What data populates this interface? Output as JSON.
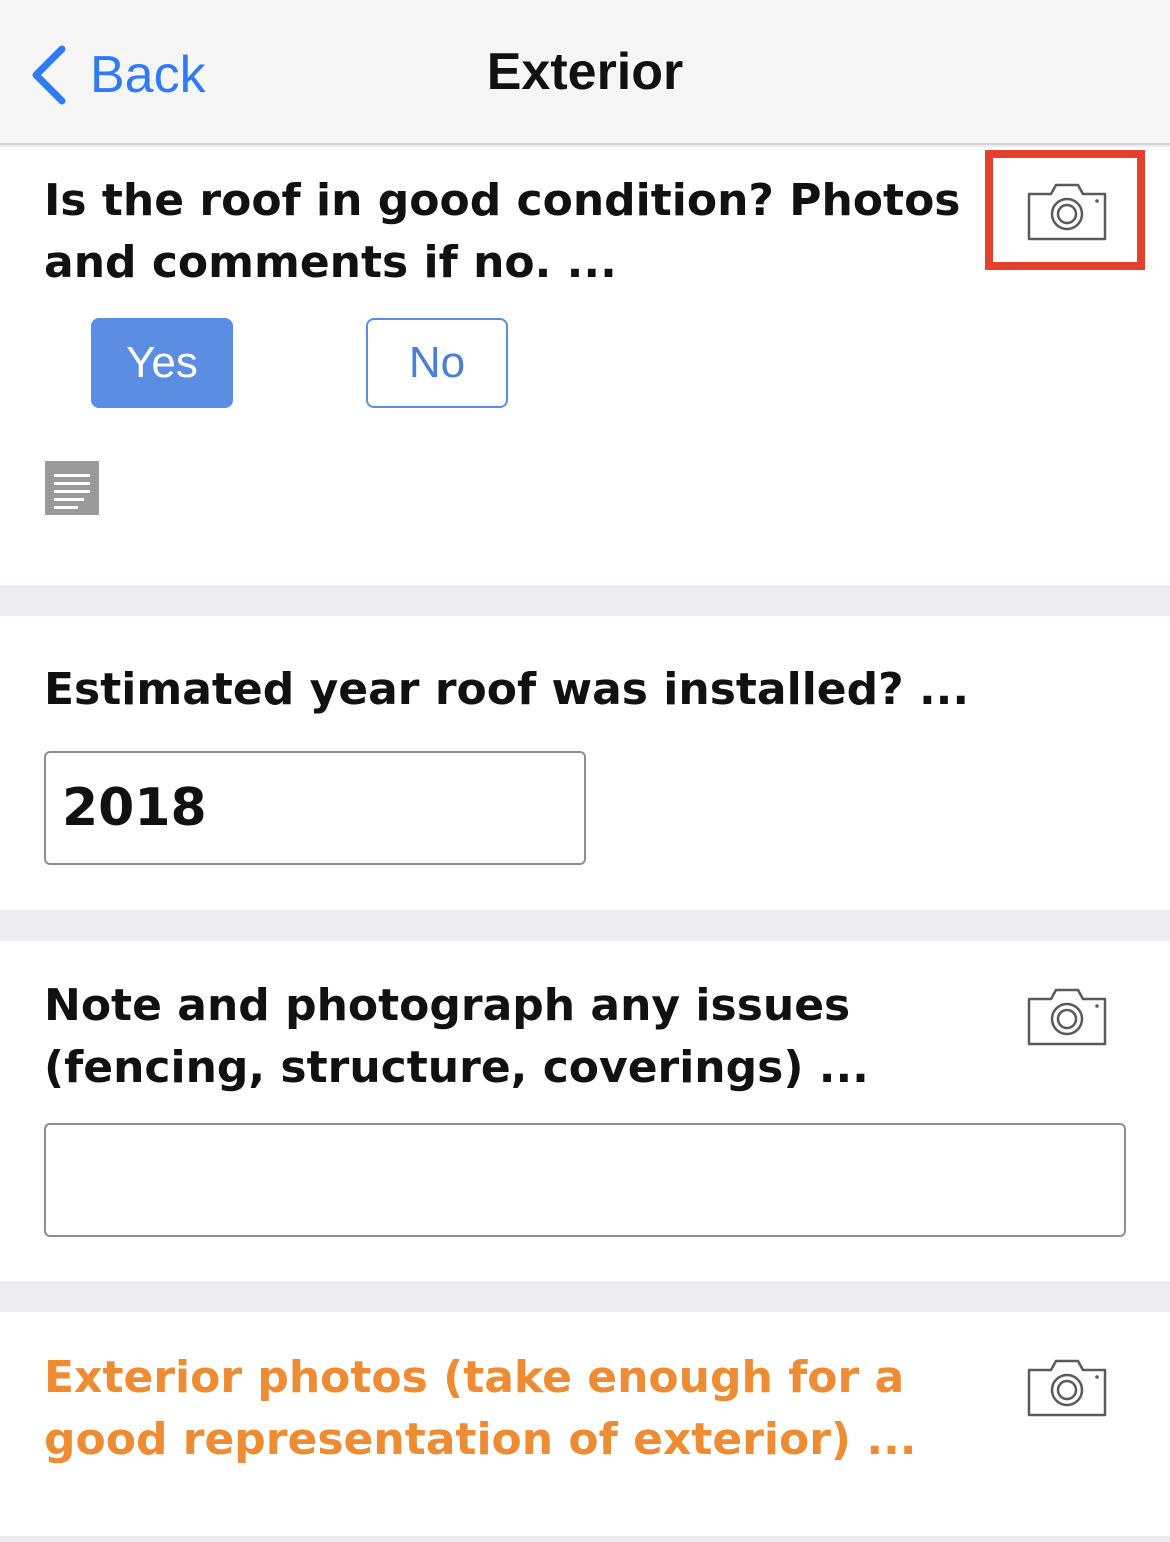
{
  "nav": {
    "back_label": "Back",
    "title": "Exterior"
  },
  "questions": [
    {
      "line1": "Is the roof in good condition?  Photos",
      "line2": "and comments if no.  ...",
      "options": {
        "yes": "Yes",
        "no": "No",
        "selected": "Yes"
      },
      "icons": [
        "camera-icon",
        "notes-icon"
      ]
    },
    {
      "line1": "Estimated year roof was installed?  ...",
      "value": "2018"
    },
    {
      "line1": "Note and photograph any issues",
      "line2": "(fencing, structure, coverings)  ...",
      "value": "",
      "icons": [
        "camera-icon"
      ]
    },
    {
      "line1": "Exterior photos (take enough for a",
      "line2": "good representation of exterior)  ...",
      "icons": [
        "camera-icon"
      ]
    }
  ],
  "colors": {
    "accent": "#2f7bf5",
    "button_selected": "#5b8ee3",
    "highlight": "#e3412b",
    "required_text": "#ee8c33"
  }
}
